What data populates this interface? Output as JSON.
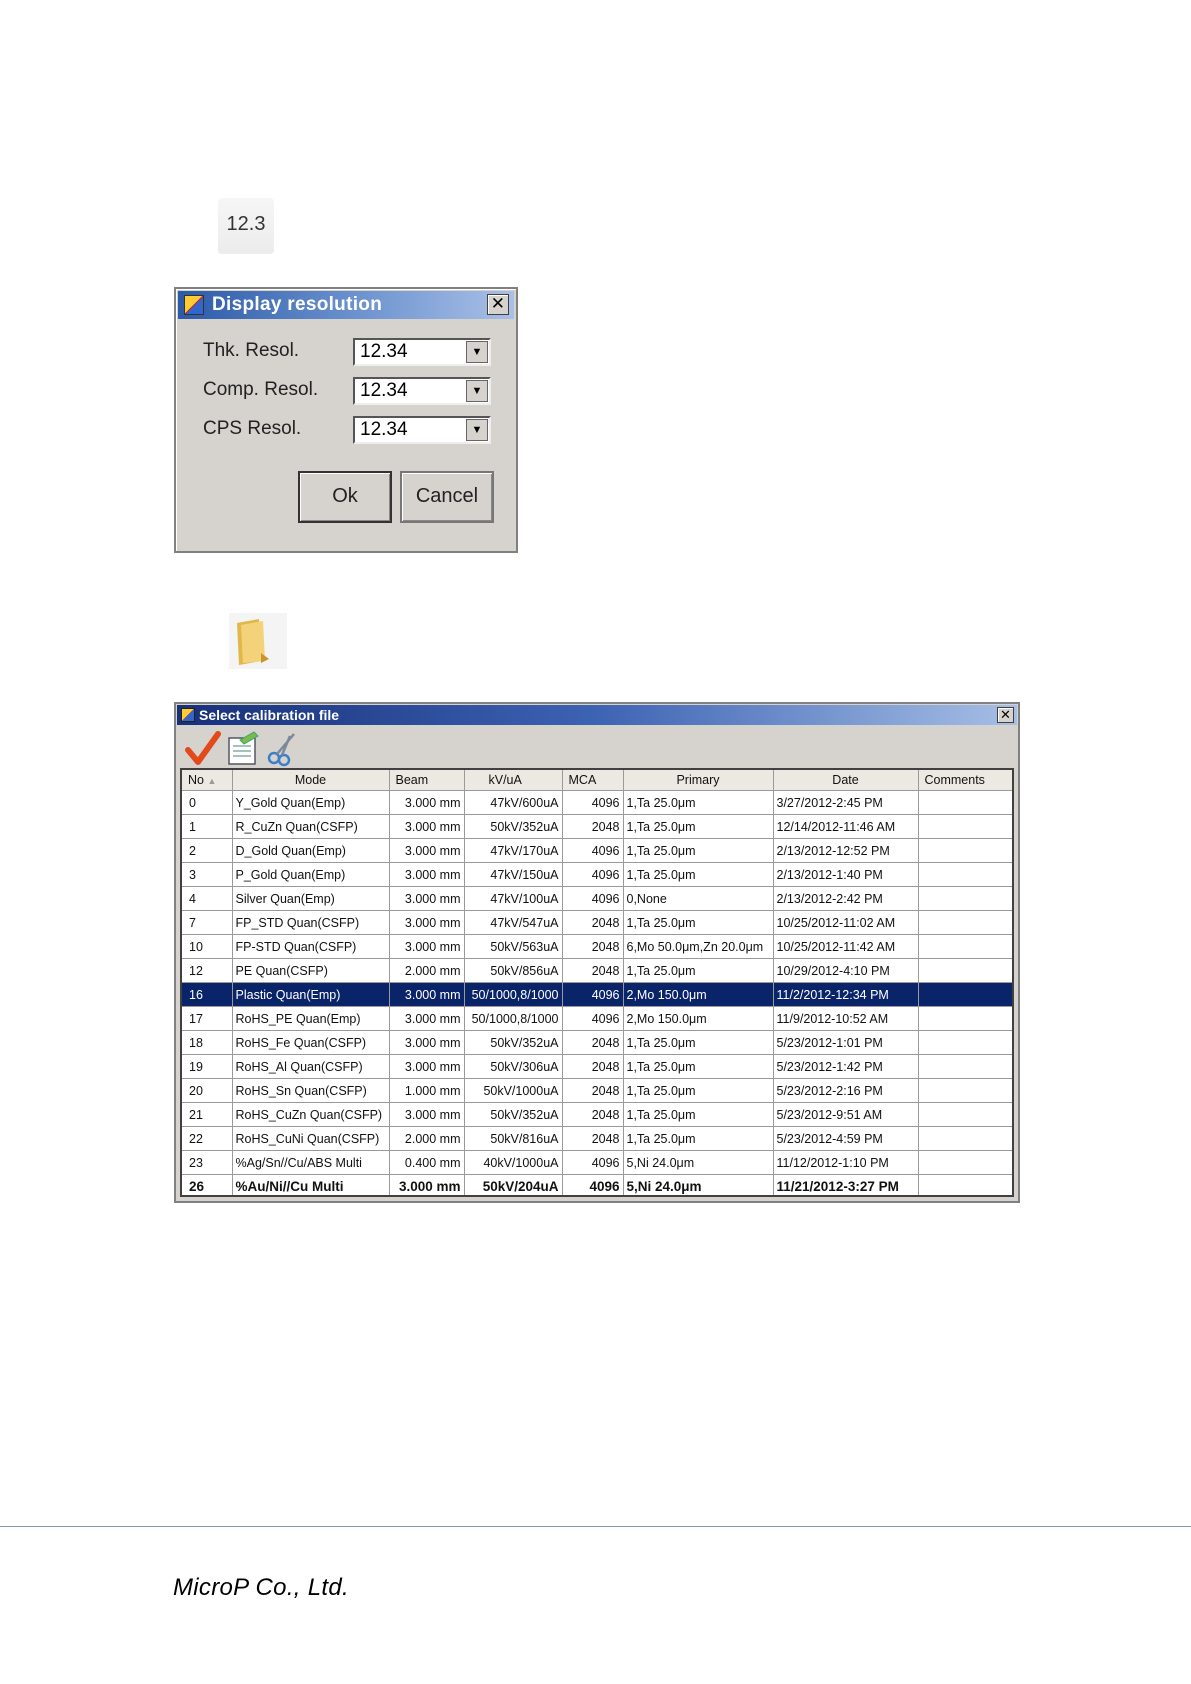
{
  "resolution_icon": {
    "label": "12.3"
  },
  "display_resolution_dialog": {
    "title": "Display resolution",
    "rows": [
      {
        "label": "Thk. Resol.",
        "value": "12.34"
      },
      {
        "label": "Comp. Resol.",
        "value": "12.34"
      },
      {
        "label": "CPS Resol.",
        "value": "12.34"
      }
    ],
    "ok_label": "Ok",
    "cancel_label": "Cancel"
  },
  "calibration_dialog": {
    "title": "Select calibration file",
    "columns": [
      "No",
      "Mode",
      "Beam",
      "kV/uA",
      "MCA",
      "Primary",
      "Date",
      "Comments"
    ],
    "rows": [
      {
        "no": "0",
        "mode": "Y_Gold Quan(Emp)",
        "beam": "3.000 mm",
        "kv": "47kV/600uA",
        "mca": "4096",
        "primary": "1,Ta 25.0μm",
        "date": "3/27/2012-2:45 PM",
        "comments": ""
      },
      {
        "no": "1",
        "mode": "R_CuZn Quan(CSFP)",
        "beam": "3.000 mm",
        "kv": "50kV/352uA",
        "mca": "2048",
        "primary": "1,Ta 25.0μm",
        "date": "12/14/2012-11:46 AM",
        "comments": ""
      },
      {
        "no": "2",
        "mode": "D_Gold Quan(Emp)",
        "beam": "3.000 mm",
        "kv": "47kV/170uA",
        "mca": "4096",
        "primary": "1,Ta 25.0μm",
        "date": "2/13/2012-12:52 PM",
        "comments": ""
      },
      {
        "no": "3",
        "mode": "P_Gold Quan(Emp)",
        "beam": "3.000 mm",
        "kv": "47kV/150uA",
        "mca": "4096",
        "primary": "1,Ta 25.0μm",
        "date": "2/13/2012-1:40 PM",
        "comments": ""
      },
      {
        "no": "4",
        "mode": "Silver Quan(Emp)",
        "beam": "3.000 mm",
        "kv": "47kV/100uA",
        "mca": "4096",
        "primary": "0,None",
        "date": "2/13/2012-2:42 PM",
        "comments": ""
      },
      {
        "no": "7",
        "mode": "FP_STD Quan(CSFP)",
        "beam": "3.000 mm",
        "kv": "47kV/547uA",
        "mca": "2048",
        "primary": "1,Ta 25.0μm",
        "date": "10/25/2012-11:02 AM",
        "comments": ""
      },
      {
        "no": "10",
        "mode": "FP-STD Quan(CSFP)",
        "beam": "3.000 mm",
        "kv": "50kV/563uA",
        "mca": "2048",
        "primary": "6,Mo 50.0μm,Zn 20.0μm",
        "date": "10/25/2012-11:42 AM",
        "comments": ""
      },
      {
        "no": "12",
        "mode": "PE Quan(CSFP)",
        "beam": "2.000 mm",
        "kv": "50kV/856uA",
        "mca": "2048",
        "primary": "1,Ta 25.0μm",
        "date": "10/29/2012-4:10 PM",
        "comments": ""
      },
      {
        "no": "16",
        "mode": "Plastic Quan(Emp)",
        "beam": "3.000 mm",
        "kv": "50/1000,8/1000",
        "mca": "4096",
        "primary": "2,Mo 150.0μm",
        "date": "11/2/2012-12:34 PM",
        "comments": "",
        "selected": true
      },
      {
        "no": "17",
        "mode": "RoHS_PE Quan(Emp)",
        "beam": "3.000 mm",
        "kv": "50/1000,8/1000",
        "mca": "4096",
        "primary": "2,Mo 150.0μm",
        "date": "11/9/2012-10:52 AM",
        "comments": ""
      },
      {
        "no": "18",
        "mode": "RoHS_Fe Quan(CSFP)",
        "beam": "3.000 mm",
        "kv": "50kV/352uA",
        "mca": "2048",
        "primary": "1,Ta 25.0μm",
        "date": "5/23/2012-1:01 PM",
        "comments": ""
      },
      {
        "no": "19",
        "mode": "RoHS_Al Quan(CSFP)",
        "beam": "3.000 mm",
        "kv": "50kV/306uA",
        "mca": "2048",
        "primary": "1,Ta 25.0μm",
        "date": "5/23/2012-1:42 PM",
        "comments": ""
      },
      {
        "no": "20",
        "mode": "RoHS_Sn Quan(CSFP)",
        "beam": "1.000 mm",
        "kv": "50kV/1000uA",
        "mca": "2048",
        "primary": "1,Ta 25.0μm",
        "date": "5/23/2012-2:16 PM",
        "comments": ""
      },
      {
        "no": "21",
        "mode": "RoHS_CuZn Quan(CSFP)",
        "beam": "3.000 mm",
        "kv": "50kV/352uA",
        "mca": "2048",
        "primary": "1,Ta 25.0μm",
        "date": "5/23/2012-9:51 AM",
        "comments": ""
      },
      {
        "no": "22",
        "mode": "RoHS_CuNi Quan(CSFP)",
        "beam": "2.000 mm",
        "kv": "50kV/816uA",
        "mca": "2048",
        "primary": "1,Ta 25.0μm",
        "date": "5/23/2012-4:59 PM",
        "comments": ""
      },
      {
        "no": "23",
        "mode": "%Ag/Sn//Cu/ABS Multi",
        "beam": "0.400 mm",
        "kv": "40kV/1000uA",
        "mca": "4096",
        "primary": "5,Ni 24.0μm",
        "date": "11/12/2012-1:10 PM",
        "comments": ""
      },
      {
        "no": "26",
        "mode": "%Au/Ni//Cu Multi",
        "beam": "3.000 mm",
        "kv": "50kV/204uA",
        "mca": "4096",
        "primary": "5,Ni 24.0μm",
        "date": "11/21/2012-3:27 PM",
        "comments": "",
        "bold": true
      }
    ]
  },
  "footer": {
    "company": "MicroP Co., Ltd."
  },
  "colors": {
    "selected_row": "#0a246a",
    "title_bar": "#2b5aa8"
  }
}
